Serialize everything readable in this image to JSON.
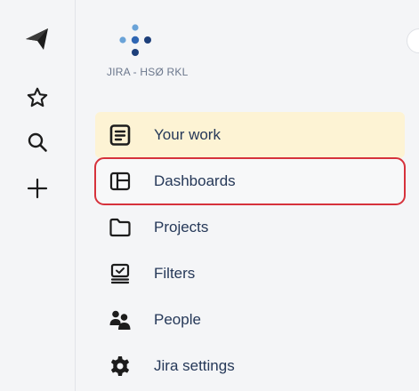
{
  "global_nav": {
    "items": [
      {
        "icon": "paper-plane-logo-icon"
      },
      {
        "icon": "star-icon"
      },
      {
        "icon": "search-icon"
      },
      {
        "icon": "plus-icon"
      }
    ]
  },
  "project": {
    "name": "JIRA - HSØ RKL",
    "logo_colors": [
      "#6aa3d8",
      "#2f66b3",
      "#1d3f7a"
    ]
  },
  "sidebar": {
    "items": [
      {
        "label": "Your work",
        "icon": "document-list-icon",
        "state": "selected"
      },
      {
        "label": "Dashboards",
        "icon": "dashboard-layout-icon",
        "state": "highlighted"
      },
      {
        "label": "Projects",
        "icon": "folder-icon",
        "state": "normal"
      },
      {
        "label": "Filters",
        "icon": "filter-monitor-icon",
        "state": "normal"
      },
      {
        "label": "People",
        "icon": "people-icon",
        "state": "normal"
      },
      {
        "label": "Jira settings",
        "icon": "gear-icon",
        "state": "normal"
      }
    ]
  },
  "colors": {
    "selected_bg": "#fdf3d4",
    "highlight_outline": "#d6323c",
    "text": "#253858",
    "icon": "#1c1c1c"
  }
}
